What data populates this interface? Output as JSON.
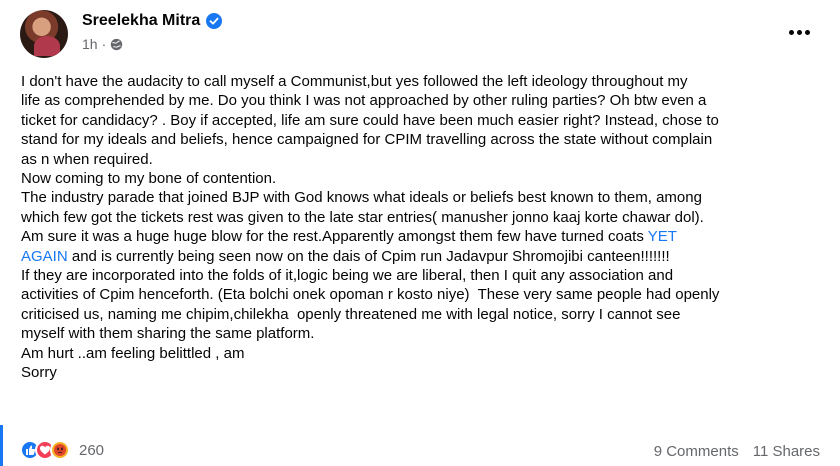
{
  "post": {
    "author": "Sreelekha Mitra",
    "time": "1h",
    "lines": [
      "I don't have the audacity to call myself a Communist,but yes followed the left ideology throughout my",
      "life as comprehended by me. Do you think I was not approached by other ruling parties? Oh btw even a",
      "ticket for candidacy? . Boy if accepted, life am sure could have been much easier right? Instead, chose to",
      "stand for my ideals and beliefs, hence campaigned for CPIM travelling across the state without complain",
      "as n when required.",
      "Now coming to my bone of contention.",
      "The industry parade that joined BJP with God knows what ideals or beliefs best known to them, among",
      "which few got the tickets rest was given to the late star entries( manusher jonno kaaj korte chawar dol).",
      "Am sure it was a huge huge blow for the rest.Apparently amongst them few have turned coats "
    ],
    "link_text": "YET",
    "line10_link": "AGAIN",
    "line10_rest": " and is currently being seen now on the dais of Cpim run Jadavpur Shromojibi canteen!!!!!!!",
    "lines_after": [
      "If they are incorporated into the folds of it,logic being we are liberal, then I quit any association and",
      "activities of Cpim henceforth. (Eta bolchi onek opoman r kosto niye)  These very same people had openly",
      "criticised us, naming me chipim,chilekha  openly threatened me with legal notice, sorry I cannot see",
      "myself with them sharing the same platform.",
      "Am hurt ..am feeling belittled , am",
      "Sorry"
    ]
  },
  "footer": {
    "reaction_count": "260",
    "comments": "9 Comments",
    "shares": "11 Shares"
  },
  "icons": {
    "verified": "verified-badge-icon",
    "globe": "globe-icon",
    "more": "more-options-icon",
    "like": "like-reaction-icon",
    "love": "love-reaction-icon",
    "angry": "angry-reaction-icon"
  },
  "colors": {
    "accent": "#1877f2",
    "meta": "#65676b",
    "text": "#050505"
  }
}
